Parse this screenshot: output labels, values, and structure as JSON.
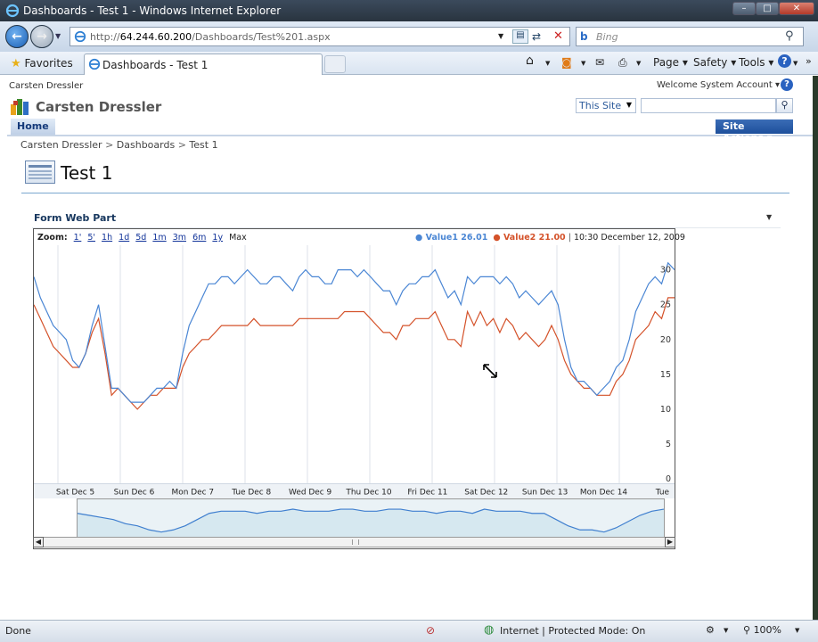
{
  "browser": {
    "window_title": "Dashboards - Test 1 - Windows Internet Explorer",
    "url_prefix": "http://",
    "url_host": "64.244.60.200",
    "url_path": "/Dashboards/Test%201.aspx",
    "search_placeholder": "Bing",
    "favorites_label": "Favorites",
    "tab_label": "Dashboards - Test 1",
    "menu": {
      "page": "Page",
      "safety": "Safety",
      "tools": "Tools"
    }
  },
  "sharepoint": {
    "site_owner": "Carsten Dressler",
    "welcome": "Welcome System Account",
    "site_title": "Carsten Dressler",
    "scope": "This Site",
    "home_tab": "Home",
    "site_actions": "Site Actions",
    "breadcrumb": [
      "Carsten Dressler",
      "Dashboards",
      "Test 1"
    ],
    "page_title": "Test 1",
    "webpart_title": "Form Web Part"
  },
  "chart_data": {
    "type": "line",
    "zoom_label": "Zoom:",
    "zoom_options": [
      "1'",
      "5'",
      "1h",
      "1d",
      "5d",
      "1m",
      "3m",
      "6m",
      "1y",
      "Max"
    ],
    "legend": [
      {
        "name": "Value1",
        "value": "26.01",
        "color": "#4a86d4"
      },
      {
        "name": "Value2",
        "value": "21.00",
        "color": "#d4522a"
      }
    ],
    "timestamp": "10:30 December 12, 2009",
    "x_labels": [
      "Sat Dec 5",
      "Sun Dec 6",
      "Mon Dec 7",
      "Tue Dec 8",
      "Wed Dec 9",
      "Thu Dec 10",
      "Fri Dec 11",
      "Sat Dec 12",
      "Sun Dec 13",
      "Mon Dec 14",
      "Tue"
    ],
    "y_ticks": [
      0,
      5,
      10,
      15,
      20,
      25,
      30
    ],
    "ylim": [
      0,
      32
    ],
    "series": [
      {
        "name": "Value1",
        "color": "#4a86d4",
        "values": [
          29,
          26,
          24,
          22,
          21,
          20,
          17,
          16,
          18,
          22,
          25,
          19,
          13,
          13,
          12,
          11,
          11,
          11,
          12,
          13,
          13,
          14,
          13,
          18,
          22,
          24,
          26,
          28,
          28,
          29,
          29,
          28,
          29,
          30,
          29,
          28,
          28,
          29,
          29,
          28,
          27,
          29,
          30,
          29,
          29,
          28,
          28,
          30,
          30,
          30,
          29,
          30,
          29,
          28,
          27,
          27,
          25,
          27,
          28,
          28,
          29,
          29,
          30,
          28,
          26,
          27,
          25,
          29,
          28,
          29,
          29,
          29,
          28,
          29,
          28,
          26,
          27,
          26,
          25,
          26,
          27,
          25,
          20,
          16,
          14,
          14,
          13,
          12,
          13,
          14,
          16,
          17,
          20,
          24,
          26,
          28,
          29,
          28,
          31,
          30
        ]
      },
      {
        "name": "Value2",
        "color": "#d4522a",
        "values": [
          25,
          23,
          21,
          19,
          18,
          17,
          16,
          16,
          18,
          21,
          23,
          18,
          12,
          13,
          12,
          11,
          10,
          11,
          12,
          12,
          13,
          13,
          13,
          16,
          18,
          19,
          20,
          20,
          21,
          22,
          22,
          22,
          22,
          22,
          23,
          22,
          22,
          22,
          22,
          22,
          22,
          23,
          23,
          23,
          23,
          23,
          23,
          23,
          24,
          24,
          24,
          24,
          23,
          22,
          21,
          21,
          20,
          22,
          22,
          23,
          23,
          23,
          24,
          22,
          20,
          20,
          19,
          24,
          22,
          24,
          22,
          23,
          21,
          23,
          22,
          20,
          21,
          20,
          19,
          20,
          22,
          20,
          17,
          15,
          14,
          13,
          13,
          12,
          12,
          12,
          14,
          15,
          17,
          20,
          21,
          22,
          24,
          23,
          26,
          26
        ]
      }
    ],
    "navigator_values": [
      21,
      20,
      19,
      18,
      16,
      15,
      13,
      12,
      13,
      15,
      18,
      21,
      22,
      22,
      22,
      21,
      22,
      22,
      23,
      22,
      22,
      22,
      23,
      23,
      22,
      22,
      23,
      23,
      22,
      22,
      21,
      22,
      22,
      21,
      23,
      22,
      22,
      22,
      21,
      21,
      18,
      15,
      13,
      13,
      12,
      14,
      17,
      20,
      22,
      23
    ]
  },
  "status": {
    "left": "Done",
    "zone": "Internet | Protected Mode: On",
    "zoom": "100%"
  }
}
